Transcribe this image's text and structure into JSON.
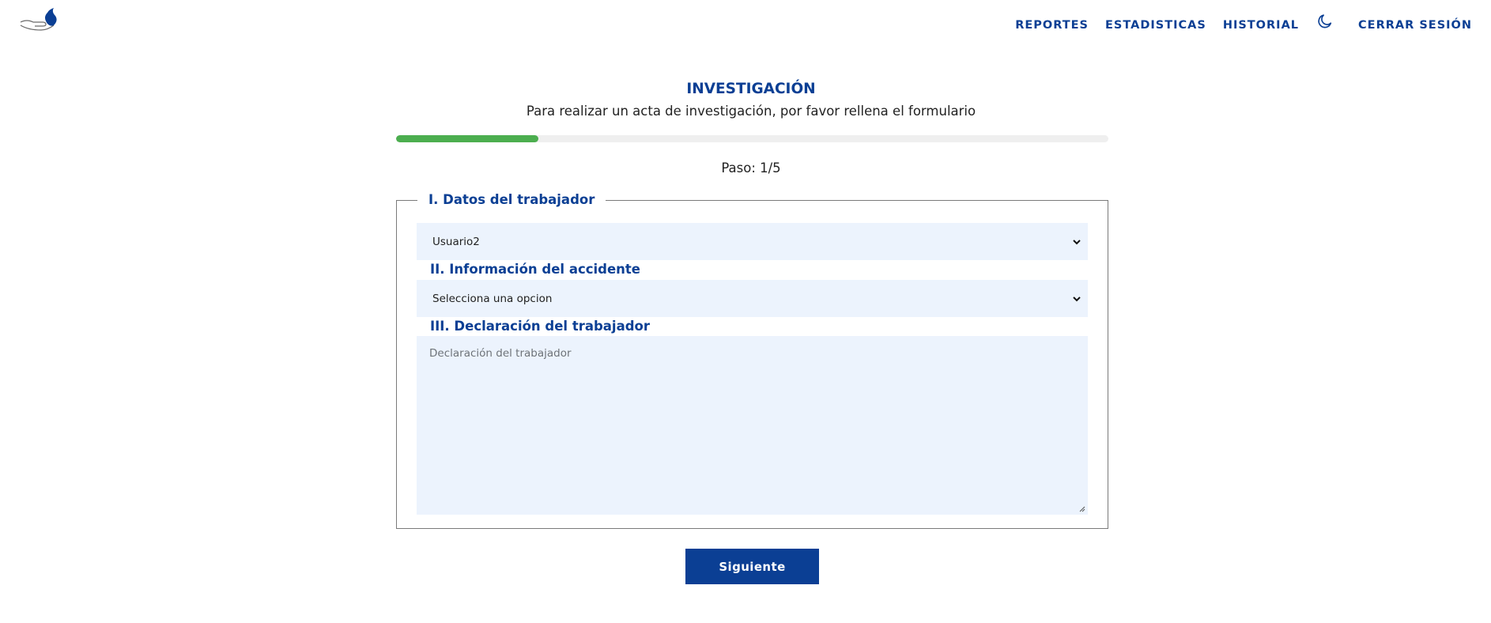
{
  "header": {
    "logo_icon": "hand-with-flame-icon",
    "nav": [
      {
        "label": "REPORTES"
      },
      {
        "label": "ESTADISTICAS"
      },
      {
        "label": "HISTORIAL"
      }
    ],
    "theme_toggle_icon": "moon-icon",
    "logout_label": "CERRAR SESIÓN"
  },
  "page": {
    "title": "INVESTIGACIÓN",
    "subtitle": "Para realizar un acta de investigación, por favor rellena el formulario",
    "progress_fraction": 0.2,
    "step_text": "Paso: 1/5"
  },
  "form": {
    "section1_legend": "I. Datos del trabajador",
    "worker_select_value": "Usuario2",
    "section2_label": "II. Información del accidente",
    "accident_select_value": "Selecciona una opcion",
    "section3_label": "III. Declaración del trabajador",
    "declaration_placeholder": "Declaración del trabajador",
    "next_button_label": "Siguiente"
  },
  "colors": {
    "primary": "#0b3f94",
    "progress": "#4cae4f",
    "field_bg": "#ecf3fd"
  }
}
